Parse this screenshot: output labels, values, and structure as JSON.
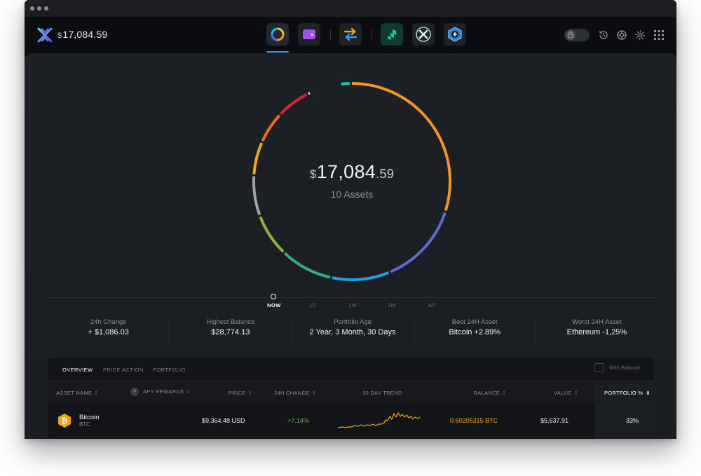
{
  "header": {
    "currency_symbol": "$",
    "balance": "17,084.59"
  },
  "apps": [
    {
      "name": "portfolio"
    },
    {
      "name": "wallet"
    },
    {
      "name": "exchange"
    },
    {
      "name": "compound"
    },
    {
      "name": "xchange"
    },
    {
      "name": "add-app"
    }
  ],
  "portfolio": {
    "currency_symbol": "$",
    "balance_main": "17,084",
    "balance_decimals": ".59",
    "assets_label": "10 Assets"
  },
  "timeline": [
    "NOW",
    "1D",
    "1W",
    "1M",
    "All"
  ],
  "stats": [
    {
      "label": "24h Change",
      "value": "+ $1,086.03"
    },
    {
      "label": "Highest Balance",
      "value": "$28,774.13"
    },
    {
      "label": "Portfolio Age",
      "value": "2 Year, 3 Month, 30 Days"
    },
    {
      "label": "Best 24H Asset",
      "value": "Bitcoin +2.89%"
    },
    {
      "label": "Worst 24H Asset",
      "value": "Ethereum -1,25%"
    }
  ],
  "tabs": [
    "OVERVIEW",
    "PRICE ACTION",
    "PORTFOLIO"
  ],
  "with_balance_label": "With Balance",
  "columns": {
    "asset_name": "ASSET NAME",
    "apy_rewards": "APY REWARDS",
    "price": "PRICE",
    "change_24h": "24H CHANGE",
    "trend": "30 DAY TREND",
    "balance": "BALANCE",
    "value": "VALUE",
    "portfolio_pct": "PORTFOLIO %"
  },
  "rows": [
    {
      "name": "Bitcoin",
      "symbol": "BTC",
      "price": "$9,364.48 USD",
      "change": "+7.14%",
      "balance": "0.60205315 BTC",
      "value": "$5,637.91",
      "portfolio_pct": "33%"
    }
  ],
  "colors": {
    "accent": "#29a3e6",
    "positive": "#58c322",
    "bitcoin": "#f7a600"
  }
}
